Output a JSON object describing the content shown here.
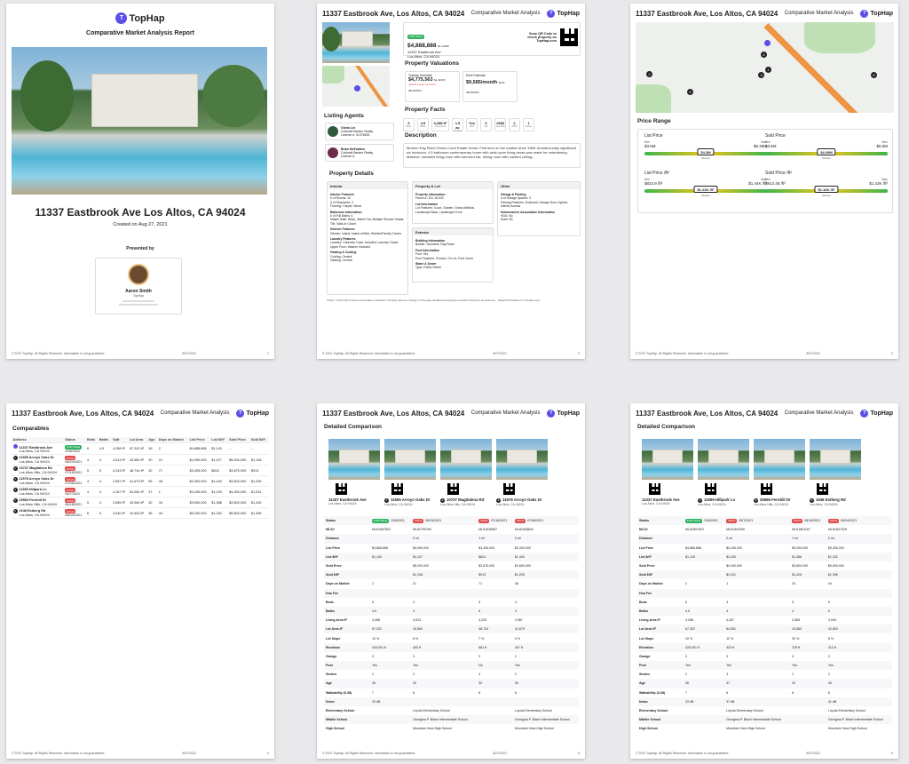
{
  "brand": "TopHap",
  "report_title": "Comparative Market Analysis Report",
  "header_address": "11337 Eastbrook Ave, Los Altos, CA 94024",
  "header_subtitle": "Comparative Market Analysis",
  "footer_copyright": "© 2021 TopHap. All Rights Reserved. Information is not guaranteed.",
  "footer_date": "8/27/2021",
  "pages": [
    "1",
    "2",
    "3",
    "4",
    "5",
    "6"
  ],
  "cover": {
    "address": "11337 Eastbrook Ave Los Altos, CA 94024",
    "created": "Created on Aug 27, 2021",
    "presented_by": "Presented by",
    "agent_name": "Aaron Smith",
    "agent_company": "TopHap"
  },
  "p2": {
    "status": "FOR SALE",
    "price": "$4,888,888",
    "price_sqft": "$1,140/ft²",
    "address_line1": "11337 Eastbrook Ave",
    "address_line2": "Los Altos, CA 94024",
    "qr_text": "Scan QR Code to check property on TopHap.com",
    "valuations_title": "Property Valuations",
    "tophap_estimate_label": "TopHap Estimate",
    "tophap_estimate": "$4,775,563",
    "tophap_estimate_sub": "$1,113/ft²",
    "tophap_estimate_note": "-$113K below List Price",
    "tophap_estimate_date": "08/16/2021",
    "rent_estimate_label": "Rent Estimate",
    "rent_estimate": "$9,585/month",
    "rent_estimate_sub": "$2/ft²",
    "rent_estimate_date": "08/16/2021",
    "facts_title": "Property Facts",
    "facts": [
      {
        "v": "6",
        "l": "Beds"
      },
      {
        "v": "4.5",
        "l": "Baths"
      },
      {
        "v": "4,288 ft²",
        "l": "Living Area"
      },
      {
        "v": "1.5 ac",
        "l": "Lot Size"
      },
      {
        "v": "Yes",
        "l": "Pool"
      },
      {
        "v": "3",
        "l": "Car"
      },
      {
        "v": "1985",
        "l": "Year Built"
      },
      {
        "v": "2",
        "l": "DOM"
      },
      {
        "v": "1",
        "l": "Stories"
      }
    ],
    "agents_title": "Listing Agents",
    "agents": [
      {
        "name": "Gloria Lin",
        "company": "Coldwell Banker Realty",
        "license": "License #: 01376553"
      },
      {
        "name": "Brian McFadden",
        "company": "Coldwell Banker Realty",
        "license": "License #:"
      }
    ],
    "description_title": "Description",
    "description": "Modern Ray Reed Tennis Court Estate Home. First time on the market since 1985. Architecturally significant six bedroom, 4.5 bathroom contemporary home with wide-open living areas was made for entertaining. Massive, elevated living room with mirrored bar, dining room with vaulted ceiling...",
    "details_title": "Property Details",
    "cols": [
      "Interior",
      "Property & Lot",
      "Other",
      "Exterior"
    ],
    "interior": [
      "Interior Features",
      "# of Rooms: 10",
      "# of Fireplaces: 2",
      "Flooring: Carpet, Wood",
      "Bathroom Information",
      "# of Full Baths: 4",
      "Master Bath: Bidet, Jetted Tub, Multiple Shower Heads, Tile, Walk-in Closet",
      "Kitchen Features",
      "Kitchen: Island, Island w/Sink, Kitchen/Family Combo",
      "Laundry Features",
      "Laundry: Cabinets, Dryer Included, Laundry Closet, Upper Floor, Washer Included",
      "Heating & Cooling",
      "Cooling: Central",
      "Heating: Central"
    ],
    "lot": [
      "Property Information",
      "Parcel #: 331-16-043",
      "Lot Information",
      "Lot Features: Court, Garden, Grass Artificial, Landscape Back, Landscape Front"
    ],
    "other": [
      "Garage & Parking",
      "# of Garage Spaces: 3",
      "Parking Features: Enclosed, Garage Door Opener, Interior Access",
      "Homeowners Association Information",
      "HOA: No",
      "Dues: $0"
    ],
    "exterior": [
      "Building Information",
      "Builder / Architect: Ray Road",
      "Pool Information",
      "Pool: Yes",
      "Pool Features: Fenced, On Lot, Pool Cover",
      "Water & Sewer",
      "Type: Public Sewer"
    ],
    "disclaimer": "(Topic): © 2021 San Francisco Association of Realtors. All rights reserved. Listings on this page identified as belonging to another listing firm are based up... (Read full disclaimer on TopHap.com)"
  },
  "p3": {
    "price_range_title": "Price Range",
    "ranges": [
      {
        "title": "List Price",
        "min": "$3.5M",
        "max": "$5.25M",
        "median": "$4.3M"
      },
      {
        "title": "Sold Price",
        "min": "$3.6M",
        "max": "$5.5M",
        "median": "$4.09M"
      },
      {
        "title": "List Price /ft²",
        "min": "$823.9 /ft²",
        "max": "$1.44K /ft²",
        "median": "$1.22K /ft²"
      },
      {
        "title": "Sold Price /ft²",
        "min": "$913.48 /ft²",
        "max": "$1.43K /ft²",
        "median": "$1.16K /ft²"
      }
    ],
    "min_label": "Min",
    "max_label": "Max",
    "median_label": "Median",
    "pins": [
      "1",
      "2",
      "3",
      "4",
      "5",
      "6"
    ]
  },
  "p4": {
    "title": "Comparables",
    "columns": [
      "Address",
      "Status",
      "Beds",
      "Baths",
      "Sqft",
      "Lot Area",
      "Age",
      "Days on Market",
      "List Price",
      "List $/ft²",
      "Sold Price",
      "Sold $/ft²"
    ],
    "rows": [
      {
        "n": "",
        "addr": "11337 Eastbrook Ave",
        "city": "Los Altos, CA 94024",
        "status": "FOR SALE",
        "date": "10/8/2021",
        "beds": "6",
        "baths": "4.5",
        "sqft": "4,288 ft²",
        "lot": "67,302 ft²",
        "age": "36",
        "dom": "2",
        "lp": "$4,888,888",
        "lpsf": "$1,140",
        "sp": "--",
        "spsf": "--"
      },
      {
        "n": "1",
        "addr": "11555 Arroyo Oaks Dr",
        "city": "Los Altos, CA 94024",
        "status": "SOLD",
        "date": "08/24/2021",
        "beds": "4",
        "baths": "4",
        "sqft": "4,513 ft²",
        "lot": "43,560 ft²",
        "age": "30",
        "dom": "21",
        "lp": "$4,995,000",
        "lpsf": "$1,107",
        "sp": "$5,000,000",
        "spsf": "$1,108"
      },
      {
        "n": "2",
        "addr": "10737 Magdalena Rd",
        "city": "Los Altos Hills, CA 94024",
        "status": "SOLD",
        "date": "07/16/2021",
        "beds": "5",
        "baths": "5",
        "sqft": "4,243 ft²",
        "lot": "48,744 ft²",
        "age": "32",
        "dom": "71",
        "lp": "$3,495,000",
        "lpsf": "$824",
        "sp": "$3,875,000",
        "spsf": "$913"
      },
      {
        "n": "3",
        "addr": "11578 Arroyo Oaks Dr",
        "city": "Los Altos, CA 94024",
        "status": "SOLD",
        "date": "07/08/2021",
        "beds": "4",
        "baths": "4",
        "sqft": "2,987 ft²",
        "lot": "41,679 ft²",
        "age": "55",
        "dom": "48",
        "lp": "$4,300,000",
        "lpsf": "$1,440",
        "sp": "$3,600,000",
        "spsf": "$1,205"
      },
      {
        "n": "4",
        "addr": "11559 Hillpark Ln",
        "city": "Los Altos, CA 94024",
        "status": "SOLD",
        "date": "05/7/2021",
        "beds": "4",
        "baths": "4",
        "sqft": "4,167 ft²",
        "lot": "54,581 ft²",
        "age": "37",
        "dom": "1",
        "lp": "$4,295,000",
        "lpsf": "$1,030",
        "sp": "$4,300,000",
        "spsf": "$1,031"
      },
      {
        "n": "5",
        "addr": "25566 Fernhill Dr",
        "city": "Los Altos Hills, CA 94024",
        "status": "SOLD",
        "date": "08/18/2021",
        "beds": "5",
        "baths": "4",
        "sqft": "2,665 ft²",
        "lot": "43,560 ft²",
        "age": "32",
        "dom": "34",
        "lp": "$3,990,000",
        "lpsf": "$1,388",
        "sp": "$3,800,000",
        "spsf": "$1,426"
      },
      {
        "n": "6",
        "addr": "1648 Estberg Rd",
        "city": "Los Altos, CA 94024",
        "status": "SOLD",
        "date": "06/04/2021",
        "beds": "6",
        "baths": "5",
        "sqft": "3,940 ft²",
        "lot": "42,653 ft²",
        "age": "36",
        "dom": "44",
        "lp": "$5,250,000",
        "lpsf": "$1,332",
        "sp": "$5,500,000",
        "spsf": "$1,396"
      }
    ]
  },
  "p5": {
    "title": "Detailed Comparison",
    "props": [
      {
        "n": "",
        "name": "11337 Eastbrook Ave",
        "city": "Los Altos, CA 94024",
        "status": "FOR SALE",
        "date": "10/8/2021"
      },
      {
        "n": "1",
        "name": "11555 Arroyo Oaks Dr",
        "city": "Los Altos, CA 94024",
        "status": "SOLD",
        "date": "08/24/2021"
      },
      {
        "n": "2",
        "name": "10737 Magdalena Rd",
        "city": "Los Altos Hills, CA 94024",
        "status": "SOLD",
        "date": "07/16/2021"
      },
      {
        "n": "3",
        "name": "11578 Arroyo Oaks Dr",
        "city": "Los Altos, CA 94024",
        "status": "SOLD",
        "date": "07/08/2021"
      }
    ],
    "rows": [
      [
        "Status",
        "",
        "",
        "",
        ""
      ],
      [
        "MLS#",
        "ML81857822",
        "ML81795782",
        "ML81835687",
        "ML81848842"
      ],
      [
        "Distance",
        "",
        "0 mi",
        "1 mi",
        "0 mi"
      ],
      [
        "List Price",
        "$4,888,888",
        "$4,995,000",
        "$3,495,000",
        "$4,300,000"
      ],
      [
        "List $/ft²",
        "$1,140",
        "$1,107",
        "$824",
        "$1,440"
      ],
      [
        "Sold Price",
        "",
        "$5,000,000",
        "$3,875,000",
        "$3,600,000"
      ],
      [
        "Sold $/ft²",
        "",
        "$1,108",
        "$913",
        "$1,205"
      ],
      [
        "Days on Market",
        "2",
        "21",
        "71",
        "48"
      ],
      [
        "Hoa Fee",
        "",
        "",
        "",
        ""
      ],
      [
        "Beds",
        "6",
        "4",
        "5",
        "4"
      ],
      [
        "Baths",
        "4.5",
        "4",
        "5",
        "4"
      ],
      [
        "Living Area ft²",
        "4,288",
        "4,513",
        "4,243",
        "2,987"
      ],
      [
        "Lot Area ft²",
        "67,302",
        "43,560",
        "48,744",
        "41,679"
      ],
      [
        "Lot Slope",
        "10 %",
        "6 %",
        "7 %",
        "5 %"
      ],
      [
        "Elevation",
        "328,051 ft",
        "400 ft",
        "581 ft",
        "407 ft"
      ],
      [
        "Garage",
        "3",
        "3",
        "3",
        "2"
      ],
      [
        "Pool",
        "Yes",
        "Yes",
        "No",
        "Yes"
      ],
      [
        "Stories",
        "2",
        "2",
        "3",
        "2"
      ],
      [
        "Age",
        "36",
        "30",
        "32",
        "55"
      ],
      [
        "Walkability (0-38)",
        "7",
        "6",
        "8",
        "6"
      ],
      [
        "Noise",
        "33 dB",
        "",
        "",
        ""
      ],
      [
        "Elementary School",
        "",
        "Loyola Elementary School",
        "",
        "Loyola Elementary School"
      ],
      [
        "Middle School",
        "",
        "Georgina P. Blach Intermediate School",
        "",
        "Georgina P. Blach Intermediate School"
      ],
      [
        "High School",
        "",
        "Mountain View High School",
        "",
        "Mountain View High School"
      ]
    ]
  },
  "p6": {
    "title": "Detailed Comparison",
    "props": [
      {
        "n": "",
        "name": "11337 Eastbrook Ave",
        "city": "Los Altos, CA 94024",
        "status": "FOR SALE",
        "date": "10/8/2021"
      },
      {
        "n": "4",
        "name": "11559 Hillpark Ln",
        "city": "Los Altos, CA 94024",
        "status": "SOLD",
        "date": "05/7/2021"
      },
      {
        "n": "5",
        "name": "25566 Fernhill Dr",
        "city": "Los Altos Hills, CA 94024",
        "status": "SOLD",
        "date": "08/18/2021"
      },
      {
        "n": "6",
        "name": "1648 Estberg Rd",
        "city": "Los Altos, CA 94024",
        "status": "SOLD",
        "date": "06/04/2021"
      }
    ],
    "rows": [
      [
        "Status",
        "",
        "",
        "",
        ""
      ],
      [
        "MLS#",
        "ML81857822",
        "ML81842096",
        "ML81851167",
        "ML81847028"
      ],
      [
        "Distance",
        "",
        "0 mi",
        "1 mi",
        "0 mi"
      ],
      [
        "List Price",
        "$4,888,888",
        "$4,295,000",
        "$3,990,000",
        "$5,250,000"
      ],
      [
        "List $/ft²",
        "$1,140",
        "$1,030",
        "$1,388",
        "$1,332"
      ],
      [
        "Sold Price",
        "",
        "$4,300,000",
        "$3,800,000",
        "$5,500,000"
      ],
      [
        "Sold $/ft²",
        "",
        "$1,031",
        "$1,426",
        "$1,396"
      ],
      [
        "Days on Market",
        "2",
        "1",
        "34",
        "44"
      ],
      [
        "Hoa Fee",
        "",
        "",
        "",
        ""
      ],
      [
        "Beds",
        "6",
        "4",
        "5",
        "6"
      ],
      [
        "Baths",
        "4.5",
        "4",
        "4",
        "5"
      ],
      [
        "Living Area ft²",
        "4,288",
        "4,167",
        "2,665",
        "3,940"
      ],
      [
        "Lot Area ft²",
        "67,302",
        "54,581",
        "43,560",
        "42,653"
      ],
      [
        "Lot Slope",
        "10 %",
        "12 %",
        "29 %",
        "8 %"
      ],
      [
        "Elevation",
        "328,051 ft",
        "323 ft",
        "378 ft",
        "312 ft"
      ],
      [
        "Garage",
        "3",
        "3",
        "3",
        "3"
      ],
      [
        "Pool",
        "Yes",
        "Yes",
        "Yes",
        "Yes"
      ],
      [
        "Stories",
        "2",
        "3",
        "2",
        "2"
      ],
      [
        "Age",
        "36",
        "37",
        "32",
        "36"
      ],
      [
        "Walkability (0-38)",
        "7",
        "8",
        "8",
        "8"
      ],
      [
        "Noise",
        "33 dB",
        "37 dB",
        "",
        "41 dB"
      ],
      [
        "Elementary School",
        "",
        "Loyola Elementary School",
        "",
        "Loyola Elementary School"
      ],
      [
        "Middle School",
        "",
        "Georgina P. Blach Intermediate School",
        "",
        "Georgina P. Blach Intermediate School"
      ],
      [
        "High School",
        "",
        "Mountain View High School",
        "",
        "Mountain View High School"
      ]
    ]
  }
}
